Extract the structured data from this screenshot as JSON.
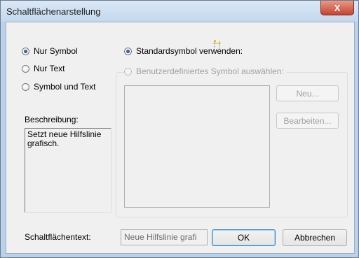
{
  "window": {
    "title": "Schaltflächenarstellung",
    "close_label": "X"
  },
  "display_mode": {
    "options": [
      "Nur Symbol",
      "Nur Text",
      "Symbol und Text"
    ],
    "selected": "Nur Symbol"
  },
  "symbol_source": {
    "standard_label": "Standardsymbol verwenden:",
    "custom_label": "Benutzerdefiniertes Symbol auswählen:",
    "selected": "standard",
    "icon": "guideline-icon"
  },
  "buttons": {
    "new": "Neu...",
    "edit": "Bearbeiten...",
    "ok": "OK",
    "cancel": "Abbrechen"
  },
  "description": {
    "label": "Beschreibung:",
    "text": "Setzt neue Hilfslinie grafisch."
  },
  "button_text": {
    "label": "Schaltflächentext:",
    "value": "Neue Hilfslinie grafi"
  }
}
